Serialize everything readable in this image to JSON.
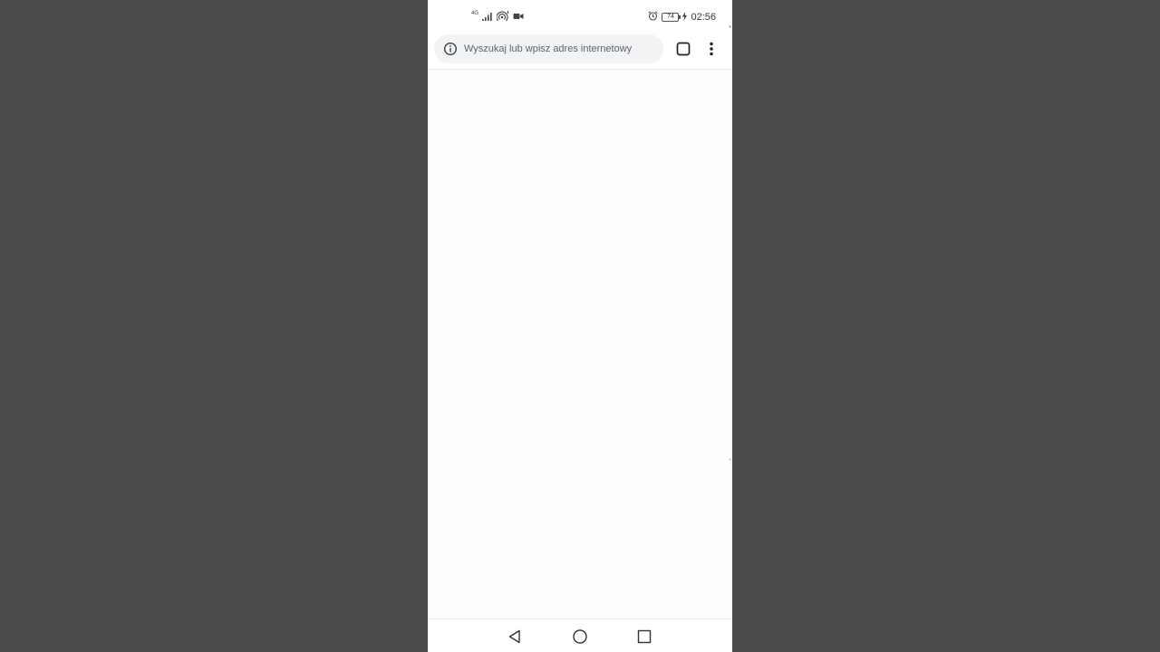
{
  "status_bar": {
    "network_type": "4G",
    "time": "02:56",
    "battery_level": "74",
    "icons": [
      "signal-icon",
      "hotspot-icon",
      "video-camera-icon",
      "alarm-icon",
      "battery-icon",
      "charging-icon"
    ]
  },
  "browser": {
    "omnibox_placeholder": "Wyszukaj lub wpisz adres internetowy",
    "icons": [
      "info-icon",
      "tab-switcher-icon",
      "more-menu-icon"
    ]
  },
  "navigation_bar": {
    "icons": [
      "back-icon",
      "home-icon",
      "recents-icon"
    ]
  },
  "colors": {
    "backdrop": "#4b4b4b",
    "screen": "#ffffff",
    "omnibox": "#f1f3f4",
    "placeholder_text": "#5f6368"
  }
}
